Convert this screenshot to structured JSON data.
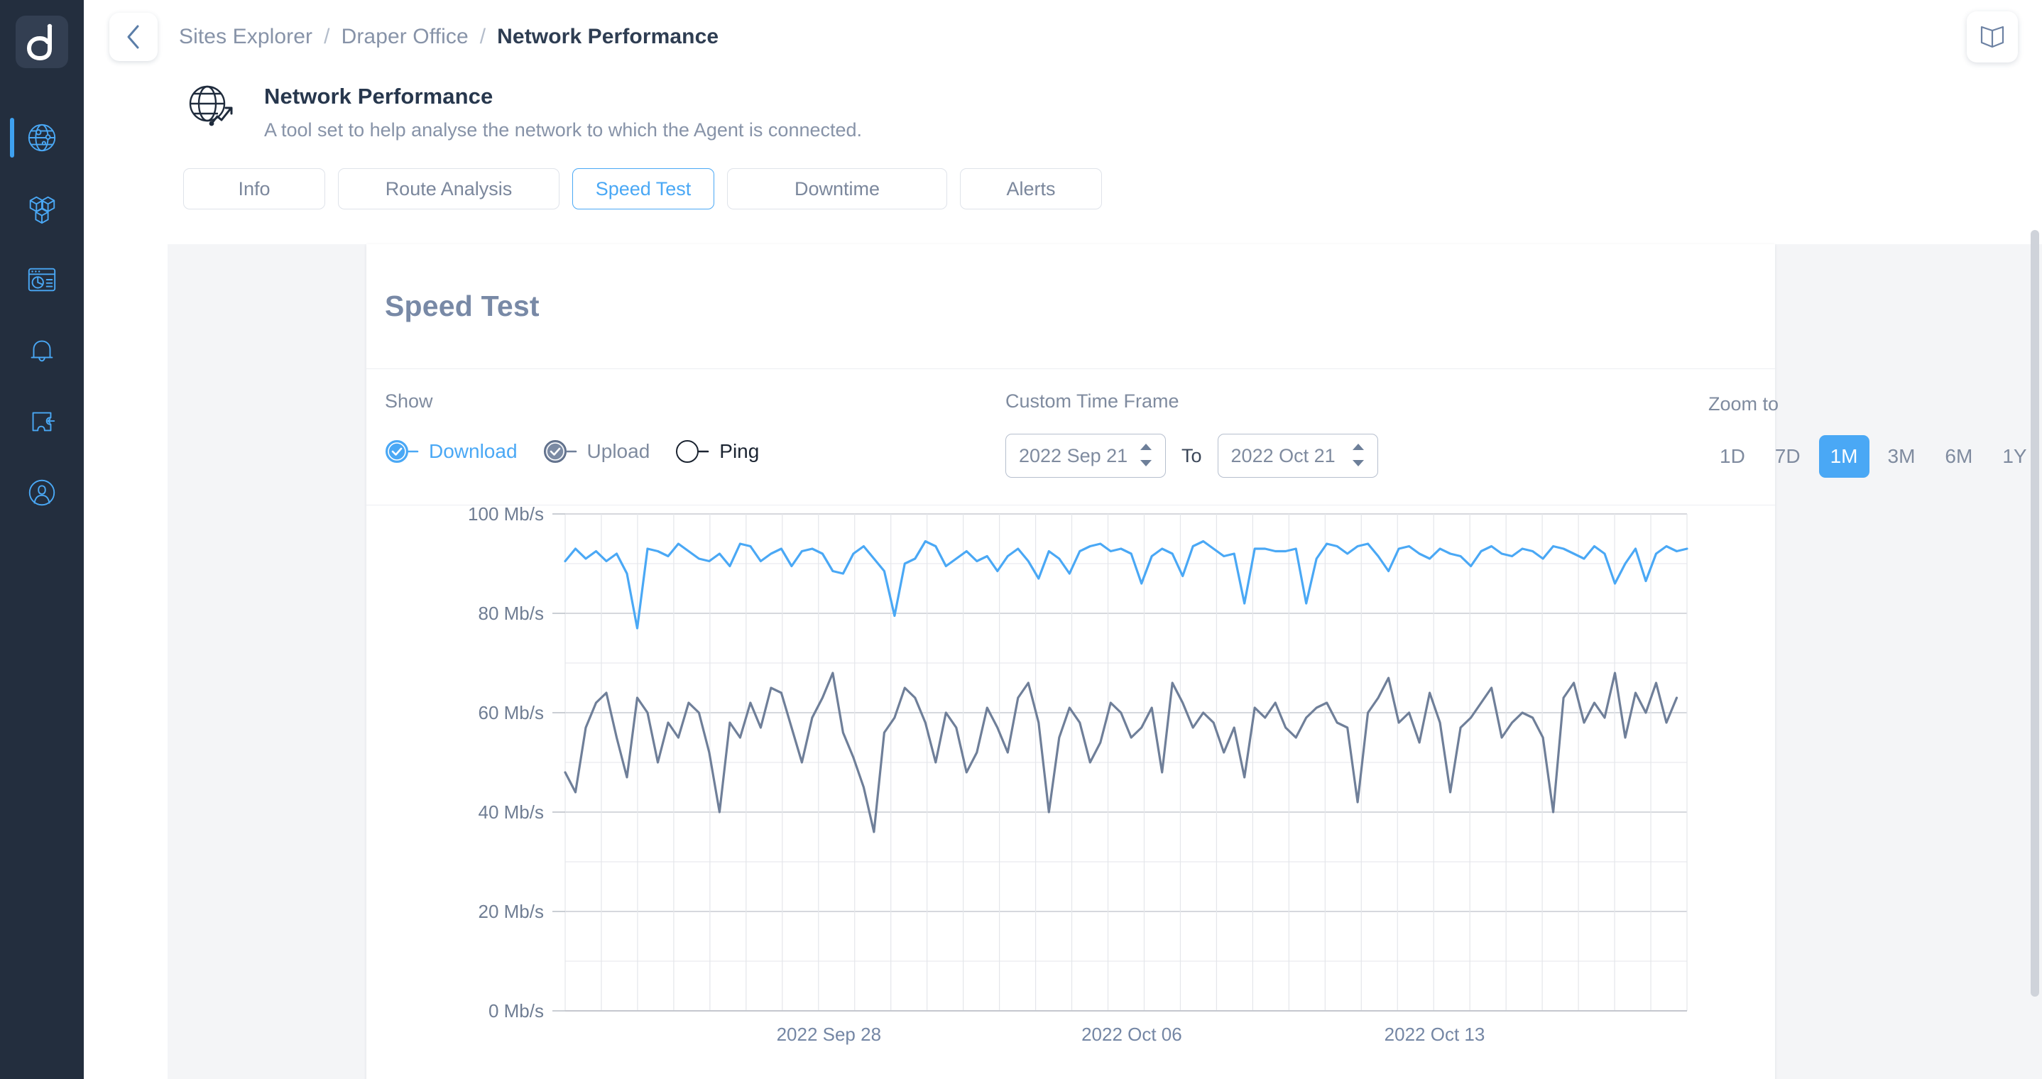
{
  "sidebar": {
    "logo_name": "datto-logo",
    "items": [
      {
        "name": "sidebar-item-network",
        "icon": "globe-network-icon",
        "active": true
      },
      {
        "name": "sidebar-item-assets",
        "icon": "cubes-icon",
        "active": false
      },
      {
        "name": "sidebar-item-reports",
        "icon": "dashboard-icon",
        "active": false
      },
      {
        "name": "sidebar-item-alerts",
        "icon": "bell-icon",
        "active": false
      },
      {
        "name": "sidebar-item-integrations",
        "icon": "puzzle-icon",
        "active": false
      },
      {
        "name": "sidebar-item-account",
        "icon": "user-circle-icon",
        "active": false
      }
    ]
  },
  "topbar": {
    "back_icon": "chevron-left-icon",
    "book_icon": "book-icon",
    "breadcrumb": [
      "Sites Explorer",
      "Draper Office",
      "Network Performance"
    ],
    "separator": "/"
  },
  "page": {
    "icon": "globe-chart-icon",
    "title": "Network Performance",
    "subtitle": "A tool set to help analyse the network to which the Agent is connected."
  },
  "tabs": [
    {
      "label": "Info",
      "active": false
    },
    {
      "label": "Route Analysis",
      "active": false
    },
    {
      "label": "Speed Test",
      "active": true
    },
    {
      "label": "Downtime",
      "active": false
    },
    {
      "label": "Alerts",
      "active": false
    }
  ],
  "card": {
    "title": "Speed Test"
  },
  "controls": {
    "show_label": "Show",
    "series": [
      {
        "label": "Download",
        "checked": true,
        "style": "blue"
      },
      {
        "label": "Upload",
        "checked": true,
        "style": "gray"
      },
      {
        "label": "Ping",
        "checked": false,
        "style": "empty"
      }
    ],
    "time_frame_label": "Custom Time Frame",
    "date_from": "2022 Sep 21",
    "date_to": "2022 Oct 21",
    "to_word": "To",
    "zoom_label": "Zoom to",
    "zoom_options": [
      {
        "label": "1D",
        "active": false
      },
      {
        "label": "7D",
        "active": false
      },
      {
        "label": "1M",
        "active": true
      },
      {
        "label": "3M",
        "active": false
      },
      {
        "label": "6M",
        "active": false
      },
      {
        "label": "1Y",
        "active": false
      }
    ]
  },
  "colors": {
    "accent": "#4aa8f5",
    "download": "#4aa8f5",
    "upload": "#6f7f99",
    "sidebar_bg": "#232e3e",
    "muted_text": "#7f8b9f",
    "heading": "#27374d"
  },
  "chart_data": {
    "type": "line",
    "title": "Speed Test",
    "xlabel": "",
    "ylabel": "",
    "ylim": [
      0,
      100
    ],
    "yticks": [
      0,
      20,
      40,
      60,
      80,
      100
    ],
    "ytick_labels": [
      "0 Mb/s",
      "20 Mb/s",
      "40 Mb/s",
      "60 Mb/s",
      "80 Mb/s",
      "100 Mb/s"
    ],
    "xtick_labels": [
      "2022 Sep 28",
      "2022 Oct 06",
      "2022 Oct 13"
    ],
    "xtick_positions": [
      0.235,
      0.505,
      0.775
    ],
    "grid": true,
    "legend_position": "top-left",
    "series": [
      {
        "name": "Download",
        "color": "#4aa8f5",
        "unit": "Mb/s",
        "values": [
          90.5,
          93,
          91,
          92.5,
          90.5,
          92,
          88,
          77,
          93,
          92.5,
          91.5,
          94,
          92.5,
          91,
          90.5,
          92,
          89.5,
          94,
          93.5,
          90.5,
          92,
          93,
          89.5,
          92.5,
          93,
          92,
          88.5,
          88,
          92,
          93.5,
          91,
          88.5,
          79.5,
          90,
          91,
          94.5,
          93.5,
          89.5,
          91,
          92.5,
          90.5,
          91.5,
          88.5,
          91.5,
          93,
          90.5,
          87,
          92.5,
          91,
          88,
          92.5,
          93.5,
          94,
          92.5,
          93,
          92,
          86,
          91.5,
          93,
          92,
          87.5,
          93.5,
          94.5,
          93,
          91.5,
          92,
          82,
          93,
          93,
          92.5,
          92.5,
          93,
          82,
          91,
          94,
          93.5,
          92,
          93.5,
          94,
          91.5,
          88.5,
          93,
          93.5,
          92,
          91,
          93,
          92,
          91.5,
          89.5,
          92.5,
          93.5,
          92,
          91.5,
          93,
          92.5,
          91,
          93.5,
          93,
          92,
          91,
          93.5,
          92,
          86,
          90,
          93,
          86.5,
          92,
          93.5,
          92.5,
          93
        ]
      },
      {
        "name": "Upload",
        "color": "#6f7f99",
        "unit": "Mb/s",
        "values": [
          48,
          44,
          57,
          62,
          64,
          55,
          47,
          63,
          60,
          50,
          58,
          55,
          62,
          60,
          52,
          40,
          58,
          55,
          62,
          57,
          65,
          64,
          57,
          50,
          59,
          63,
          68,
          56,
          51,
          45,
          36,
          56,
          59,
          65,
          63,
          58,
          50,
          60,
          57,
          48,
          52,
          61,
          57,
          52,
          63,
          66,
          58,
          40,
          55,
          61,
          58,
          50,
          54,
          62,
          60,
          55,
          57,
          61,
          48,
          66,
          62,
          57,
          60,
          58,
          52,
          57,
          47,
          61,
          59,
          62,
          57,
          55,
          59,
          61,
          62,
          58,
          57,
          42,
          60,
          63,
          67,
          58,
          60,
          54,
          64,
          58,
          44,
          57,
          59,
          62,
          65,
          55,
          58,
          60,
          59,
          55,
          40,
          63,
          66,
          58,
          62,
          59,
          68,
          55,
          64,
          60,
          66,
          58,
          63
        ]
      }
    ]
  }
}
